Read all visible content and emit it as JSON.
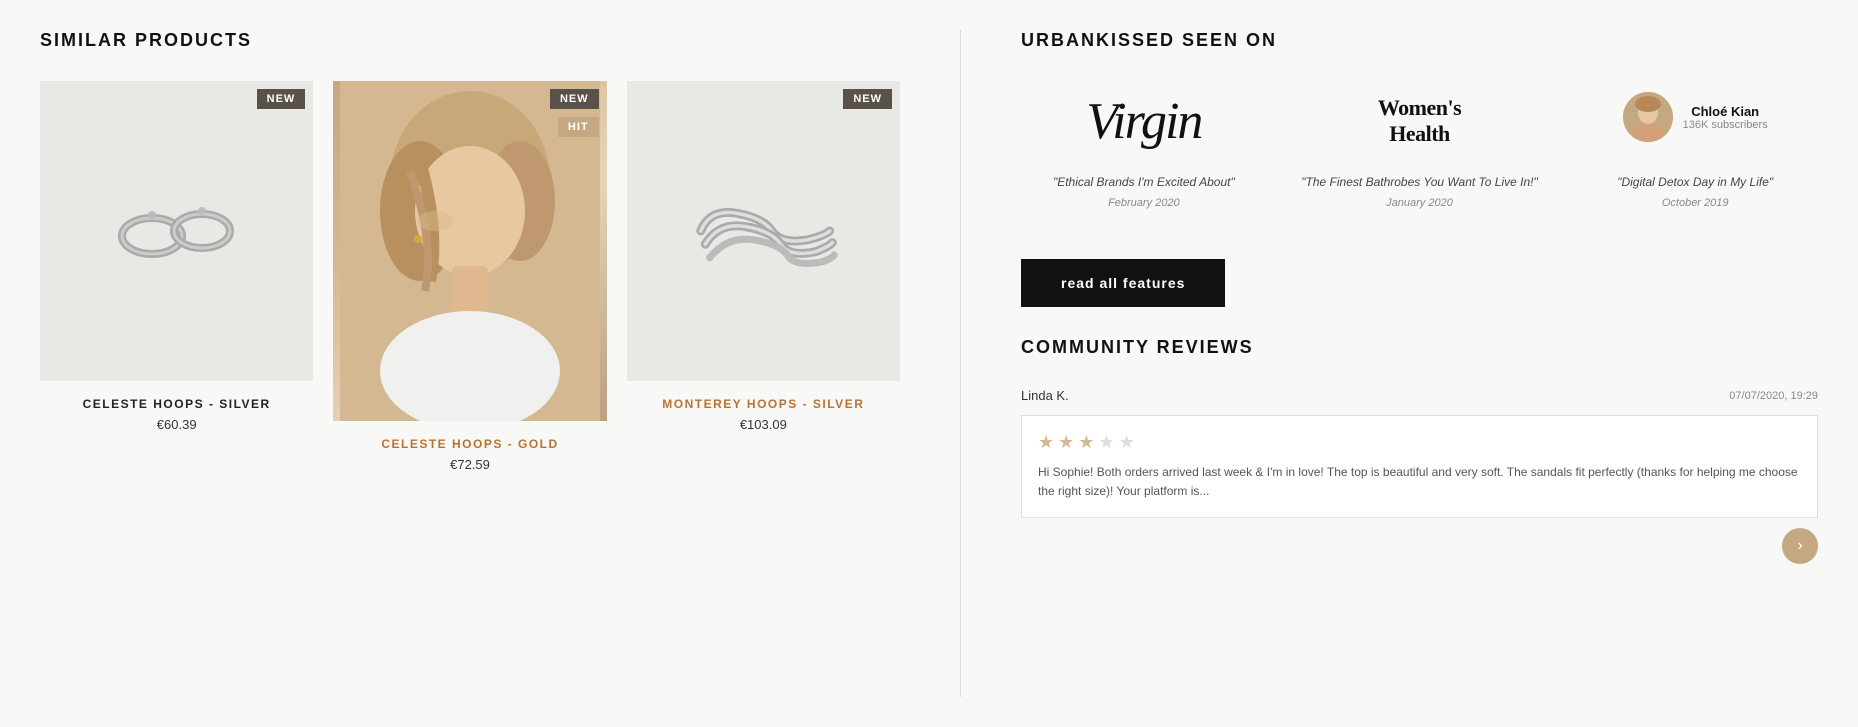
{
  "left": {
    "section_title": "SIMILAR PRODUCTS",
    "products": [
      {
        "id": "celeste-silver",
        "name": "CELESTE HOOPS - SILVER",
        "price": "€60.39",
        "badge": "NEW",
        "badge_type": "new",
        "has_hit": false,
        "type": "silver"
      },
      {
        "id": "celeste-gold",
        "name": "CELESTE HOOPS - GOLD",
        "price": "€72.59",
        "badge": "NEW",
        "badge_type": "new",
        "has_hit": true,
        "hit_label": "HIT",
        "type": "gold"
      },
      {
        "id": "monterey-silver",
        "name": "MONTEREY HOOPS - SILVER",
        "price": "€103.09",
        "badge": "NEW",
        "badge_type": "new",
        "has_hit": false,
        "type": "monterey"
      }
    ]
  },
  "right": {
    "section_title": "URBANKISSED SEEN ON",
    "logos": [
      {
        "id": "virgin",
        "name": "Virgin",
        "quote": "\"Ethical Brands I'm Excited About\"",
        "date": "February 2020"
      },
      {
        "id": "womens-health",
        "name": "Women'sHealth",
        "quote": "\"The Finest Bathrobes You Want To Live In!\"",
        "date": "January 2020"
      },
      {
        "id": "chloe-kian",
        "name": "Chloé Kian",
        "subscribers": "136K subscribers",
        "quote": "\"Digital Detox Day in My Life\"",
        "date": "October 2019"
      }
    ],
    "read_all_label": "read all features",
    "community": {
      "title": "COMMUNITY REVIEWS",
      "reviewer": "Linda K.",
      "date": "07/07/2020, 19:29",
      "stars": 3,
      "review_text": "Hi Sophie! Both orders arrived last week & I'm in love! The top is beautiful and very soft. The sandals fit perfectly (thanks for helping me choose the right size)! Your platform is..."
    }
  }
}
